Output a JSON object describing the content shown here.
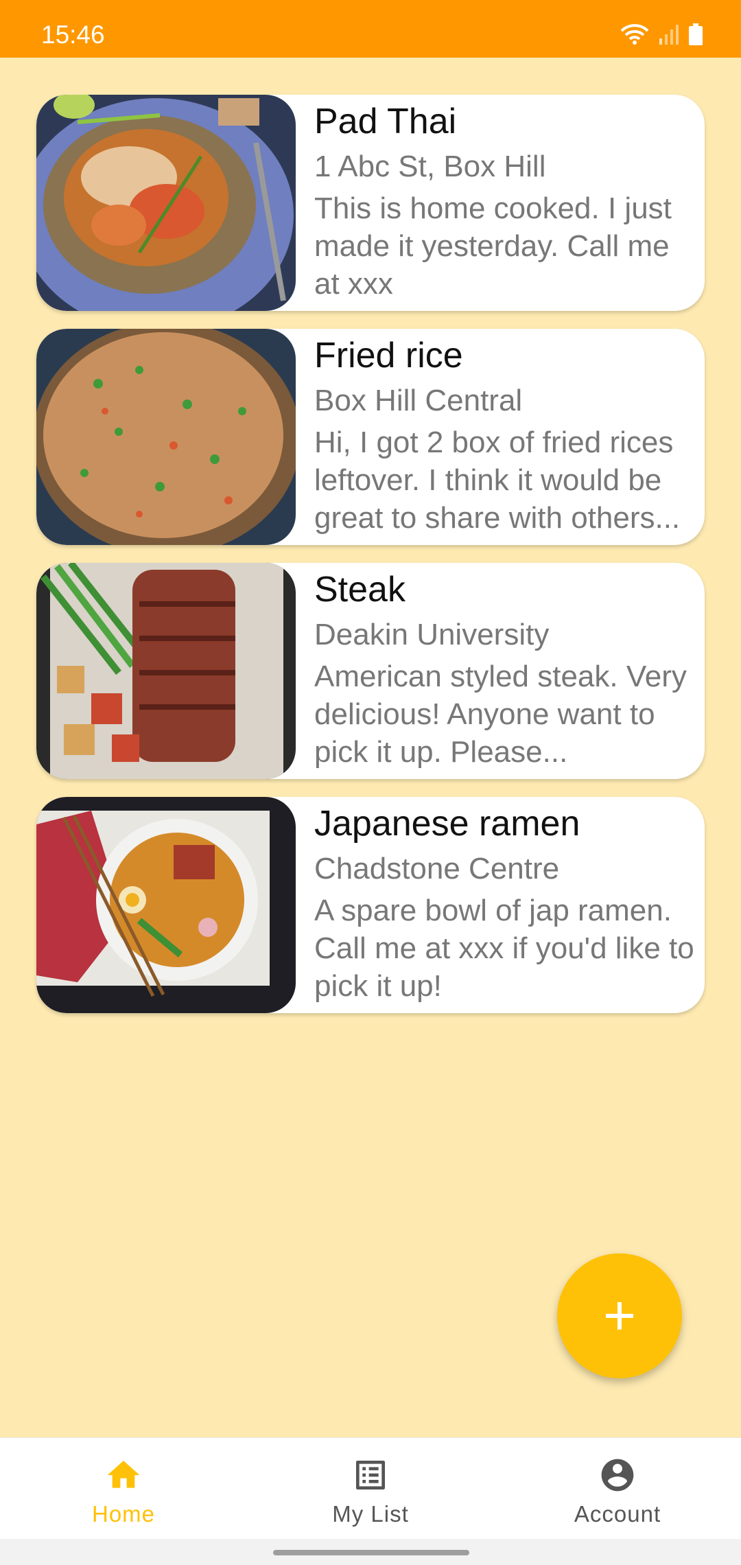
{
  "status_bar": {
    "time": "15:46",
    "icons": [
      "wifi-icon",
      "signal-icon",
      "battery-icon"
    ]
  },
  "posts": [
    {
      "title": "Pad Thai",
      "location": "1 Abc St, Box Hill",
      "description": "This is home cooked. I just made it yesterday. Call me at xxx",
      "image": "pad-thai-photo"
    },
    {
      "title": "Fried rice",
      "location": "Box Hill Central",
      "description": "Hi, I got 2 box of fried rices leftover. I think it would be great to share with others...",
      "image": "fried-rice-photo"
    },
    {
      "title": "Steak",
      "location": "Deakin University",
      "description": "American styled steak. Very delicious! Anyone want to pick it up. Please...",
      "image": "steak-photo"
    },
    {
      "title": "Japanese ramen",
      "location": "Chadstone Centre",
      "description": "A spare bowl of jap ramen. Call me at xxx if you'd like to pick it up!",
      "image": "ramen-photo"
    }
  ],
  "fab": {
    "icon": "plus-icon"
  },
  "bottom_nav": {
    "items": [
      {
        "label": "Home",
        "icon": "home-icon",
        "active": true
      },
      {
        "label": "My List",
        "icon": "list-icon",
        "active": false
      },
      {
        "label": "Account",
        "icon": "account-icon",
        "active": false
      }
    ]
  },
  "colors": {
    "status_bar": "#FF9800",
    "background": "#FEEAB1",
    "fab": "#FFC107",
    "nav_active": "#FFC107",
    "nav_inactive": "#555555"
  }
}
